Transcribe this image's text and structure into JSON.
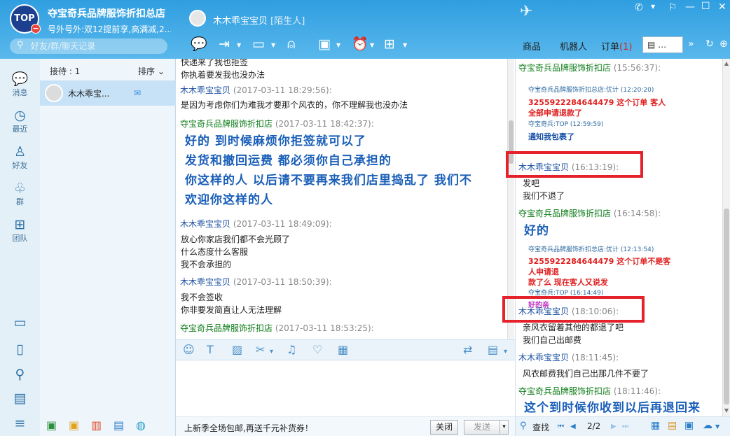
{
  "app": {
    "logo_text": "TOP",
    "logo_badge": "−",
    "shop_name": "夺宝奇兵品牌服饰折扣总店",
    "signature": "号外号外:双12提前享,高满减,2...",
    "search_placeholder": "好友/群/聊天记录"
  },
  "contact_header": {
    "name": "木木乖宝宝贝",
    "status": "[陌生人]"
  },
  "window_controls": {
    "phone": "✆",
    "pin": "⚐",
    "minimize": "—",
    "maximize": "☐",
    "close": "✕"
  },
  "right_tabs": {
    "goods": "商品",
    "robot": "机器人",
    "orders": "订单",
    "orders_count": "(1)",
    "more": "…",
    "more_arrow": "»"
  },
  "left_nav": [
    {
      "icon": "💬",
      "label": "消息"
    },
    {
      "icon": "◷",
      "label": "最近"
    },
    {
      "icon": "♙",
      "label": "好友"
    },
    {
      "icon": "♧",
      "label": "群"
    },
    {
      "icon": "⊞",
      "label": "团队"
    }
  ],
  "left_nav_bottom": [
    "▭",
    "▯",
    "⚲",
    "▤",
    "≡"
  ],
  "contacts": {
    "reception_label": "接待 : 1",
    "sort_label": "排序 ⌄",
    "items": [
      {
        "name": "木木乖宝...",
        "status_icon": "✉"
      }
    ]
  },
  "chat": {
    "messages": [
      {
        "body": [
          "快递来了我也拒签",
          "你执着要发我也没办法"
        ]
      },
      {
        "sender": "木木乖宝宝贝",
        "time": "(2017-03-11 18:29:56):",
        "body": [
          "是因为考虑你们为难我才要那个风衣的，你不理解我也没办法"
        ]
      },
      {
        "sender": "夺宝奇兵品牌服饰折扣店",
        "time": "(2017-03-11 18:42:37):",
        "big": [
          "好的  到时候麻烦你拒签就可以了",
          "发货和撤回运费  都必须你自己承担的",
          "你这样的人  以后请不要再来我们店里捣乱了  我们不",
          "欢迎你这样的人"
        ]
      },
      {
        "sender": "木木乖宝宝贝",
        "time": "(2017-03-11 18:49:09):",
        "body": [
          "放心你家店我们都不会光顾了",
          "什么态度什么客服",
          "我不会承担的"
        ]
      },
      {
        "sender": "木木乖宝宝贝",
        "time": "(2017-03-11 18:50:39):",
        "body": [
          "我不会签收",
          "你非要发简直让人无法理解"
        ]
      },
      {
        "sender": "夺宝奇兵品牌服饰折扣店",
        "time": "(2017-03-11 18:53:25):"
      }
    ]
  },
  "input_toolbar": [
    "☺",
    "T",
    "▨",
    "✂",
    "▾",
    "♫",
    "♡",
    "▦",
    "⇄",
    "▤",
    "▾"
  ],
  "footer": {
    "promo": "上新季全场包邮,再送千元补货券！",
    "close_btn": "关闭",
    "send_btn": "发送",
    "send_arrow": "▾"
  },
  "history": {
    "m1": {
      "sender": "夺宝奇兵品牌服饰折扣店",
      "time": "(15:56:37):"
    },
    "clip1": {
      "l1": "夺宝奇兵品牌服饰折扣总店:优计 (12:20:20)",
      "l2": "3255922284644479 这个订单 客人",
      "l3": "全部申请退款了",
      "l4": "夺宝奇兵:TOP (12:59:59)",
      "l5": "通知我包裹了"
    },
    "m2": {
      "sender": "木木乖宝宝贝",
      "time": "(16:13:19):",
      "body": [
        "发吧",
        "我们不退了"
      ]
    },
    "m3": {
      "sender": "夺宝奇兵品牌服饰折扣店",
      "time": "(16:14:58):",
      "big": "好的"
    },
    "clip2": {
      "l1": "夺宝奇兵品牌服饰折扣总店:优计 (12:13:54)",
      "l2": "3255922284644479 这个订单不是客人申请退",
      "l3": "款了么 现在客人又说发",
      "l4": "夺宝奇兵:TOP (16:14:49)",
      "l5": "好的亲"
    },
    "m4": {
      "sender": "木木乖宝宝贝",
      "time": "(18:10:06):",
      "body": [
        "亲风衣留着其他的都退了吧",
        "我们自己出邮费"
      ]
    },
    "m5": {
      "sender": "木木乖宝宝贝",
      "time": "(18:11:45):",
      "body": [
        "风衣邮费我们自己出那几件不要了"
      ]
    },
    "m6": {
      "sender": "夺宝奇兵品牌服饰折扣店",
      "time": "(18:11:46):",
      "big": "这个到时候你收到以后再退回来"
    },
    "footer": {
      "search": "查找",
      "page": "2/2"
    }
  },
  "colors": {
    "accent": "#3aa3e3",
    "highlight": "#e5222b",
    "shop_green": "#0f7d1a",
    "user_blue": "#1a4fa0",
    "big_text": "#1a5fb8"
  }
}
